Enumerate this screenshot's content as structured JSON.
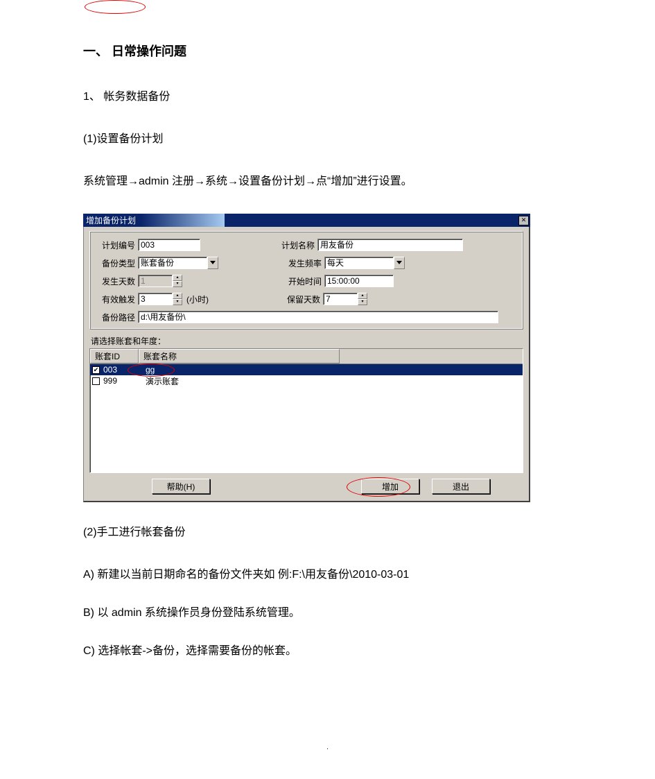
{
  "doc": {
    "heading": "一、  日常操作问题",
    "item1": "1、  帐务数据备份",
    "sub1": "(1)设置备份计划",
    "instr1": "系统管理→admin 注册→系统→设置备份计划→点“增加”进行设置。",
    "sub2": "(2)手工进行帐套备份",
    "stepA": "A)  新建以当前日期命名的备份文件夹如  例:F:\\用友备份\\2010-03-01",
    "stepB": "B)  以 admin 系统操作员身份登陆系统管理。",
    "stepC": "C)  选择帐套->备份，选择需要备份的帐套。",
    "page_num": "."
  },
  "dialog": {
    "title": "增加备份计划",
    "close_x": "✕",
    "fields": {
      "plan_no_lbl": "计划编号",
      "plan_no": "003",
      "plan_name_lbl": "计划名称",
      "plan_name": "用友备份",
      "backup_type_lbl": "备份类型",
      "backup_type": "账套备份",
      "freq_lbl": "发生频率",
      "freq": "每天",
      "days_lbl": "发生天数",
      "days": "1",
      "start_lbl": "开始时间",
      "start": "15:00:00",
      "trigger_lbl": "有效触发",
      "trigger": "3",
      "hour_note": "(小时)",
      "keep_lbl": "保留天数",
      "keep": "7",
      "path_lbl": "备份路径",
      "path": "d:\\用友备份\\"
    },
    "list": {
      "section_label": "请选择账套和年度：",
      "header1": "账套ID",
      "header2": "账套名称",
      "rows": [
        {
          "checked": true,
          "id": "003",
          "name": "gg",
          "selected": true
        },
        {
          "checked": false,
          "id": "999",
          "name": "演示账套",
          "selected": false
        }
      ]
    },
    "buttons": {
      "help": "帮助(H)",
      "add": "增加",
      "exit": "退出"
    }
  }
}
